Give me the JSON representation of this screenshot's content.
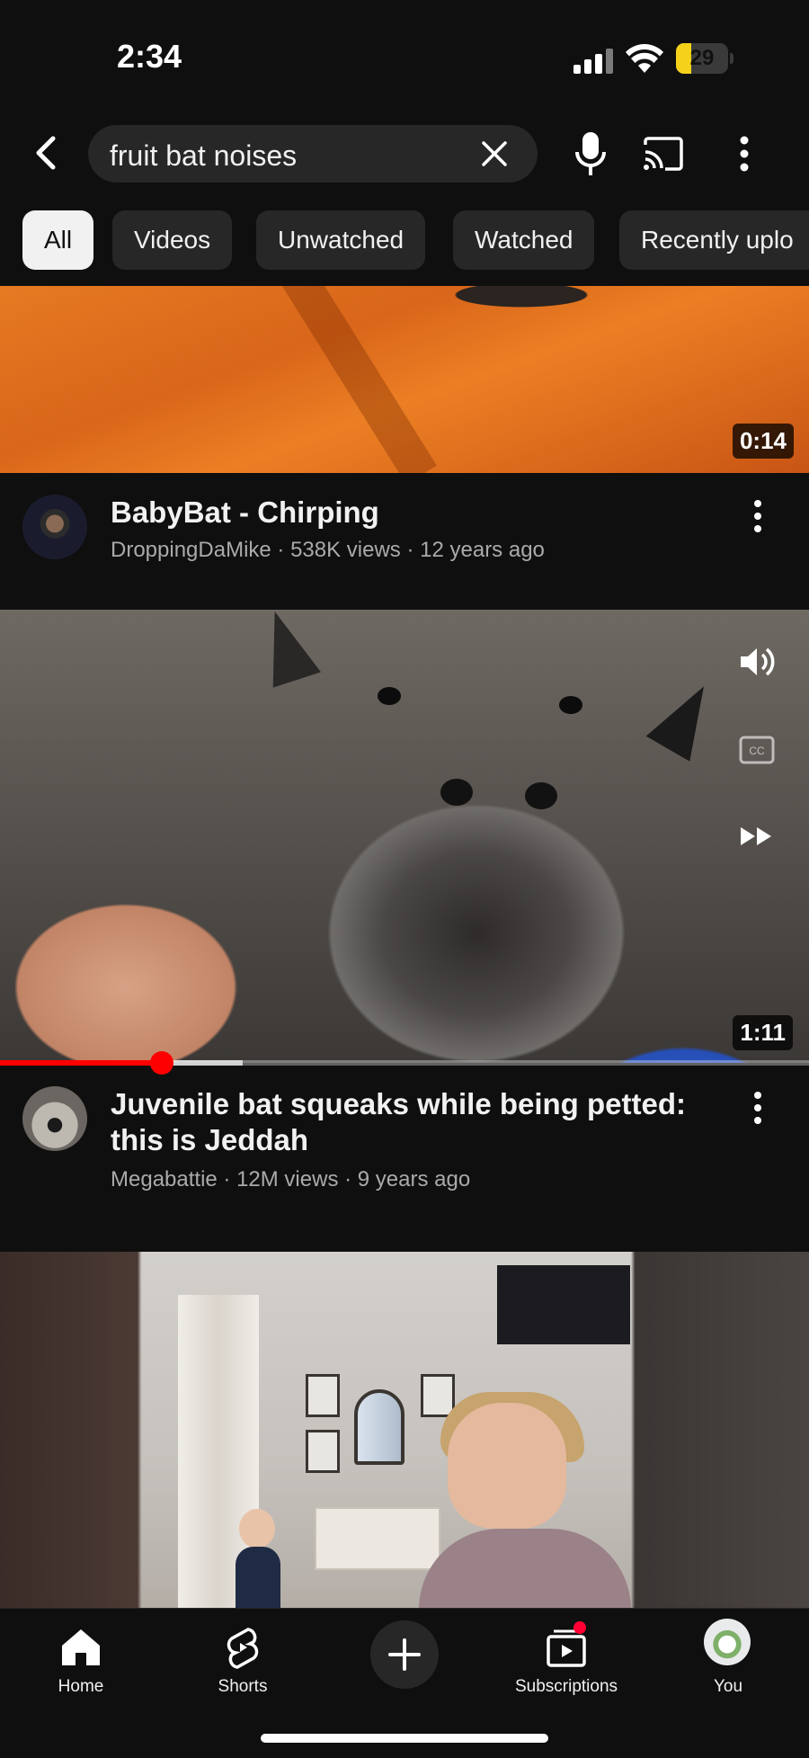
{
  "status_bar": {
    "time": "2:34",
    "battery": "29",
    "battery_level": 0.29
  },
  "header": {
    "search_query": "fruit bat noises"
  },
  "chips": [
    "All",
    "Videos",
    "Unwatched",
    "Watched",
    "Recently uplo"
  ],
  "videos": [
    {
      "title": "BabyBat - Chirping",
      "meta": "DroppingDaMike · 538K views · 12 years ago",
      "duration": "0:14"
    },
    {
      "title": "Juvenile bat squeaks while being petted: this is Jeddah",
      "meta": "Megabattie · 12M views · 9 years ago",
      "duration": "1:11",
      "progress": 0.2
    }
  ],
  "nav": {
    "home": "Home",
    "shorts": "Shorts",
    "subscriptions": "Subscriptions",
    "you": "You"
  },
  "colors": {
    "accent": "#ff0000",
    "background": "#0f0f0f",
    "chip_bg": "#272727"
  }
}
